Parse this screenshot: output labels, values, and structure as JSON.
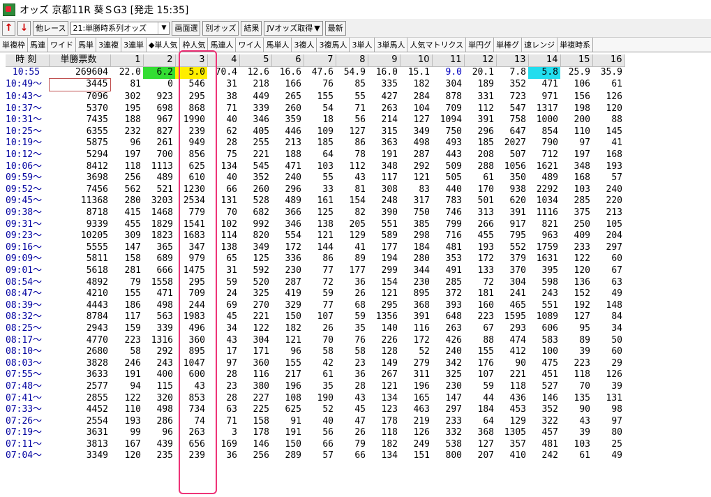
{
  "window": {
    "title": "オッズ 京都11R 葵ＳG3 [発走 15:35]"
  },
  "toolbar": {
    "other_race": "他レース",
    "select_value": "21:単勝時系列オッズ",
    "screen_select": "画面選",
    "other_odds": "別オッズ",
    "result": "結果",
    "jv_fetch": "JVオッズ取得",
    "latest": "最新"
  },
  "tabs": [
    "単複枠",
    "馬連",
    "ワイド",
    "馬単",
    "3連複",
    "3連単",
    "◆単人気",
    "枠人気",
    "馬連人",
    "ワイ人",
    "馬単人",
    "3複人",
    "3複馬人",
    "3単人",
    "3単馬人",
    "人気マトリクス",
    "単円グ",
    "単棒グ",
    "速レンジ",
    "単複時系"
  ],
  "active_tab_index": 6,
  "table": {
    "header_time": "時 刻",
    "header_total": "単勝票数",
    "horses": [
      "1",
      "2",
      "3",
      "4",
      "5",
      "6",
      "7",
      "8",
      "9",
      "10",
      "11",
      "12",
      "13",
      "14",
      "15",
      "16"
    ],
    "odds_row": {
      "time": "10:55",
      "total": "269604",
      "values": [
        "22.0",
        "6.2",
        "5.0",
        "70.4",
        "12.6",
        "16.6",
        "47.6",
        "54.9",
        "16.0",
        "15.1",
        "9.0",
        "20.1",
        "7.8",
        "5.8",
        "25.9",
        "35.9"
      ]
    },
    "rows": [
      {
        "time": "10:49～",
        "total": "3445",
        "values": [
          "81",
          "0",
          "546",
          "31",
          "218",
          "166",
          "76",
          "85",
          "335",
          "182",
          "304",
          "189",
          "352",
          "471",
          "106",
          "61"
        ]
      },
      {
        "time": "10:43～",
        "total": "7096",
        "values": [
          "302",
          "923",
          "295",
          "38",
          "449",
          "265",
          "155",
          "55",
          "427",
          "284",
          "878",
          "331",
          "723",
          "971",
          "156",
          "126"
        ]
      },
      {
        "time": "10:37～",
        "total": "5370",
        "values": [
          "195",
          "698",
          "868",
          "71",
          "339",
          "260",
          "54",
          "71",
          "263",
          "104",
          "709",
          "112",
          "547",
          "1317",
          "198",
          "120"
        ]
      },
      {
        "time": "10:31～",
        "total": "7435",
        "values": [
          "188",
          "967",
          "1990",
          "40",
          "346",
          "359",
          "18",
          "56",
          "214",
          "127",
          "1094",
          "391",
          "758",
          "1000",
          "200",
          "88"
        ]
      },
      {
        "time": "10:25～",
        "total": "6355",
        "values": [
          "232",
          "827",
          "239",
          "62",
          "405",
          "446",
          "109",
          "127",
          "315",
          "349",
          "750",
          "296",
          "647",
          "854",
          "110",
          "145"
        ]
      },
      {
        "time": "10:19～",
        "total": "5875",
        "values": [
          "96",
          "261",
          "949",
          "28",
          "255",
          "213",
          "185",
          "86",
          "363",
          "498",
          "493",
          "185",
          "2027",
          "790",
          "97",
          "41"
        ]
      },
      {
        "time": "10:12～",
        "total": "5294",
        "values": [
          "197",
          "700",
          "856",
          "75",
          "221",
          "188",
          "64",
          "78",
          "191",
          "287",
          "443",
          "208",
          "507",
          "712",
          "197",
          "168"
        ]
      },
      {
        "time": "10:06～",
        "total": "8412",
        "values": [
          "118",
          "1113",
          "625",
          "134",
          "545",
          "471",
          "103",
          "112",
          "348",
          "292",
          "509",
          "288",
          "1056",
          "1621",
          "348",
          "193"
        ]
      },
      {
        "time": "09:59～",
        "total": "3698",
        "values": [
          "256",
          "489",
          "610",
          "40",
          "352",
          "240",
          "55",
          "43",
          "117",
          "121",
          "505",
          "61",
          "350",
          "489",
          "168",
          "57"
        ]
      },
      {
        "time": "09:52～",
        "total": "7456",
        "values": [
          "562",
          "521",
          "1230",
          "66",
          "260",
          "296",
          "33",
          "81",
          "308",
          "83",
          "440",
          "170",
          "938",
          "2292",
          "103",
          "240"
        ]
      },
      {
        "time": "09:45～",
        "total": "11368",
        "values": [
          "280",
          "3203",
          "2534",
          "131",
          "528",
          "489",
          "161",
          "154",
          "248",
          "317",
          "783",
          "501",
          "620",
          "1034",
          "285",
          "220"
        ]
      },
      {
        "time": "09:38～",
        "total": "8718",
        "values": [
          "415",
          "1468",
          "779",
          "70",
          "682",
          "366",
          "125",
          "82",
          "390",
          "750",
          "746",
          "313",
          "391",
          "1116",
          "375",
          "213"
        ]
      },
      {
        "time": "09:31～",
        "total": "9339",
        "values": [
          "455",
          "1829",
          "1541",
          "102",
          "992",
          "346",
          "138",
          "205",
          "551",
          "385",
          "799",
          "266",
          "917",
          "821",
          "250",
          "105"
        ]
      },
      {
        "time": "09:23～",
        "total": "10205",
        "values": [
          "309",
          "1823",
          "1683",
          "114",
          "820",
          "554",
          "121",
          "129",
          "589",
          "298",
          "716",
          "455",
          "795",
          "963",
          "409",
          "204"
        ]
      },
      {
        "time": "09:16～",
        "total": "5555",
        "values": [
          "147",
          "365",
          "347",
          "138",
          "349",
          "172",
          "144",
          "41",
          "177",
          "184",
          "481",
          "193",
          "552",
          "1759",
          "233",
          "297"
        ]
      },
      {
        "time": "09:09～",
        "total": "5811",
        "values": [
          "158",
          "689",
          "979",
          "65",
          "125",
          "336",
          "86",
          "89",
          "194",
          "280",
          "353",
          "172",
          "379",
          "1631",
          "122",
          "60"
        ]
      },
      {
        "time": "09:01～",
        "total": "5618",
        "values": [
          "281",
          "666",
          "1475",
          "31",
          "592",
          "230",
          "77",
          "177",
          "299",
          "344",
          "491",
          "133",
          "370",
          "395",
          "120",
          "67"
        ]
      },
      {
        "time": "08:54～",
        "total": "4892",
        "values": [
          "79",
          "1558",
          "295",
          "59",
          "520",
          "287",
          "72",
          "36",
          "154",
          "230",
          "285",
          "72",
          "304",
          "598",
          "136",
          "63"
        ]
      },
      {
        "time": "08:47～",
        "total": "4210",
        "values": [
          "155",
          "471",
          "709",
          "24",
          "325",
          "419",
          "59",
          "26",
          "121",
          "895",
          "372",
          "181",
          "241",
          "243",
          "152",
          "49"
        ]
      },
      {
        "time": "08:39～",
        "total": "4443",
        "values": [
          "186",
          "498",
          "244",
          "69",
          "270",
          "329",
          "77",
          "68",
          "295",
          "368",
          "393",
          "160",
          "465",
          "551",
          "192",
          "148"
        ]
      },
      {
        "time": "08:32～",
        "total": "8784",
        "values": [
          "117",
          "563",
          "1983",
          "45",
          "221",
          "150",
          "107",
          "59",
          "1356",
          "391",
          "648",
          "223",
          "1595",
          "1089",
          "127",
          "84"
        ]
      },
      {
        "time": "08:25～",
        "total": "2943",
        "values": [
          "159",
          "339",
          "496",
          "34",
          "122",
          "182",
          "26",
          "35",
          "140",
          "116",
          "263",
          "67",
          "293",
          "606",
          "95",
          "34"
        ]
      },
      {
        "time": "08:17～",
        "total": "4770",
        "values": [
          "223",
          "1316",
          "360",
          "43",
          "304",
          "121",
          "70",
          "76",
          "226",
          "172",
          "426",
          "88",
          "474",
          "583",
          "89",
          "50"
        ]
      },
      {
        "time": "08:10～",
        "total": "2680",
        "values": [
          "58",
          "292",
          "895",
          "17",
          "171",
          "96",
          "58",
          "58",
          "128",
          "52",
          "240",
          "155",
          "412",
          "100",
          "39",
          "60"
        ]
      },
      {
        "time": "08:03～",
        "total": "3828",
        "values": [
          "246",
          "243",
          "1047",
          "97",
          "360",
          "155",
          "42",
          "23",
          "149",
          "279",
          "342",
          "176",
          "90",
          "475",
          "223",
          "29"
        ]
      },
      {
        "time": "07:55～",
        "total": "3633",
        "values": [
          "191",
          "400",
          "600",
          "28",
          "116",
          "217",
          "61",
          "36",
          "267",
          "311",
          "325",
          "107",
          "221",
          "451",
          "118",
          "126"
        ]
      },
      {
        "time": "07:48～",
        "total": "2577",
        "values": [
          "94",
          "115",
          "43",
          "23",
          "380",
          "196",
          "35",
          "28",
          "121",
          "196",
          "230",
          "59",
          "118",
          "527",
          "70",
          "39"
        ]
      },
      {
        "time": "07:41～",
        "total": "2855",
        "values": [
          "122",
          "320",
          "853",
          "28",
          "227",
          "108",
          "190",
          "43",
          "134",
          "165",
          "147",
          "44",
          "436",
          "146",
          "135",
          "131"
        ]
      },
      {
        "time": "07:33～",
        "total": "4452",
        "values": [
          "110",
          "498",
          "734",
          "63",
          "225",
          "625",
          "52",
          "45",
          "123",
          "463",
          "297",
          "184",
          "453",
          "352",
          "90",
          "98"
        ]
      },
      {
        "time": "07:26～",
        "total": "2554",
        "values": [
          "193",
          "286",
          "74",
          "71",
          "158",
          "91",
          "40",
          "47",
          "178",
          "219",
          "233",
          "64",
          "129",
          "322",
          "43",
          "97"
        ]
      },
      {
        "time": "07:19～",
        "total": "3631",
        "values": [
          "99",
          "96",
          "263",
          "3",
          "178",
          "191",
          "56",
          "26",
          "118",
          "126",
          "332",
          "368",
          "1305",
          "457",
          "39",
          "80"
        ]
      },
      {
        "time": "07:11～",
        "total": "3813",
        "values": [
          "167",
          "439",
          "656",
          "169",
          "146",
          "150",
          "66",
          "79",
          "182",
          "249",
          "538",
          "127",
          "357",
          "481",
          "103",
          "25"
        ]
      },
      {
        "time": "07:04～",
        "total": "3349",
        "values": [
          "120",
          "235",
          "239",
          "36",
          "256",
          "289",
          "57",
          "66",
          "134",
          "151",
          "800",
          "207",
          "410",
          "242",
          "61",
          "49"
        ]
      }
    ]
  },
  "highlight_colors": {
    "green": "#33dd33",
    "yellow": "#ffee00",
    "cyan": "#22ddee",
    "frame": "#ee3377"
  },
  "highlights": {
    "green_col": 1,
    "yellow_col": 2,
    "cyan_col": 13,
    "framed_col": 2
  }
}
